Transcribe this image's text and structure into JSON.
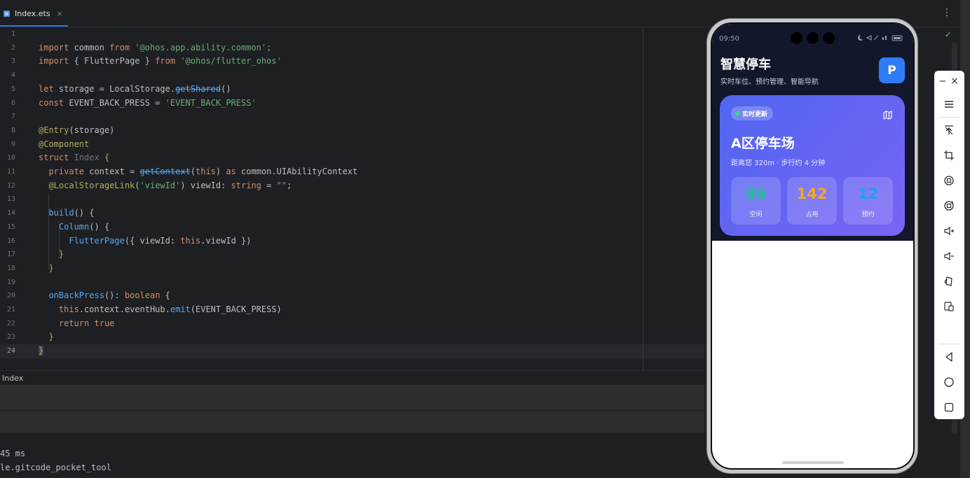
{
  "tab": {
    "filename": "Index.ets",
    "close": "×"
  },
  "menu_glyph": "⋮",
  "code_lines": [
    {
      "n": "1"
    },
    {
      "n": "2"
    },
    {
      "n": "3"
    },
    {
      "n": "4"
    },
    {
      "n": "5"
    },
    {
      "n": "6"
    },
    {
      "n": "7"
    },
    {
      "n": "8"
    },
    {
      "n": "9"
    },
    {
      "n": "10"
    },
    {
      "n": "11"
    },
    {
      "n": "12"
    },
    {
      "n": "13"
    },
    {
      "n": "14"
    },
    {
      "n": "15"
    },
    {
      "n": "16"
    },
    {
      "n": "17"
    },
    {
      "n": "18"
    },
    {
      "n": "19"
    },
    {
      "n": "20"
    },
    {
      "n": "21"
    },
    {
      "n": "22"
    },
    {
      "n": "23"
    },
    {
      "n": "24"
    }
  ],
  "code": {
    "l2": [
      "import",
      " common ",
      "from",
      " '@ohos.app.ability.common';"
    ],
    "l3": [
      "import",
      " { FlutterPage } ",
      "from",
      " '@ohos/flutter_ohos'"
    ],
    "l5": [
      "let",
      " storage = LocalStorage.",
      "getShared",
      "()"
    ],
    "l6": [
      "const",
      " EVENT_BACK_PRESS = ",
      "'EVENT_BACK_PRESS'"
    ],
    "l8": [
      "@Entry",
      "(storage)"
    ],
    "l9": [
      "@Component"
    ],
    "l10": [
      "struct",
      " Index ",
      "{"
    ],
    "l11": [
      "private",
      " context = ",
      "getContext",
      "(",
      "this",
      ") ",
      "as",
      " common.",
      "UIAbilityContext"
    ],
    "l12": [
      "@LocalStorageLink",
      "(",
      "'viewId'",
      ") viewId: ",
      "string",
      " = ",
      "\"\"",
      ";"
    ],
    "l14": [
      "build",
      "() {"
    ],
    "l15": [
      "Column",
      "() {"
    ],
    "l16": [
      "FlutterPage",
      "({ viewId: ",
      "this",
      ".viewId })"
    ],
    "l17": [
      "}"
    ],
    "l18": [
      "}"
    ],
    "l20": [
      "onBackPress",
      "(): ",
      "boolean",
      " {"
    ],
    "l21": [
      "this",
      ".context.eventHub.",
      "emit",
      "(EVENT_BACK_PRESS)"
    ],
    "l22": [
      "return",
      " ",
      "true"
    ],
    "l23": [
      "}"
    ],
    "l24": [
      "}"
    ]
  },
  "breadcrumb": "Index",
  "console": {
    "line1": "45 ms",
    "line2": "le.gitcode_pocket_tool"
  },
  "phone": {
    "status_time": "09:50",
    "app_title": "智慧停车",
    "app_subtitle": "实时车位、预约管理、智能导航",
    "avatar_letter": "P",
    "card": {
      "badge": "实时更新",
      "lot_name": "A区停车场",
      "lot_sub": "距离您 320m · 步行约 4 分钟",
      "stats": [
        {
          "value": "86",
          "label": "空闲",
          "color": "#1fbf8f"
        },
        {
          "value": "142",
          "label": "占用",
          "color": "#f5a623"
        },
        {
          "value": "12",
          "label": "预约",
          "color": "#1aa6e8"
        }
      ]
    }
  },
  "toolbar": {
    "minimize": "−",
    "close": "×"
  }
}
